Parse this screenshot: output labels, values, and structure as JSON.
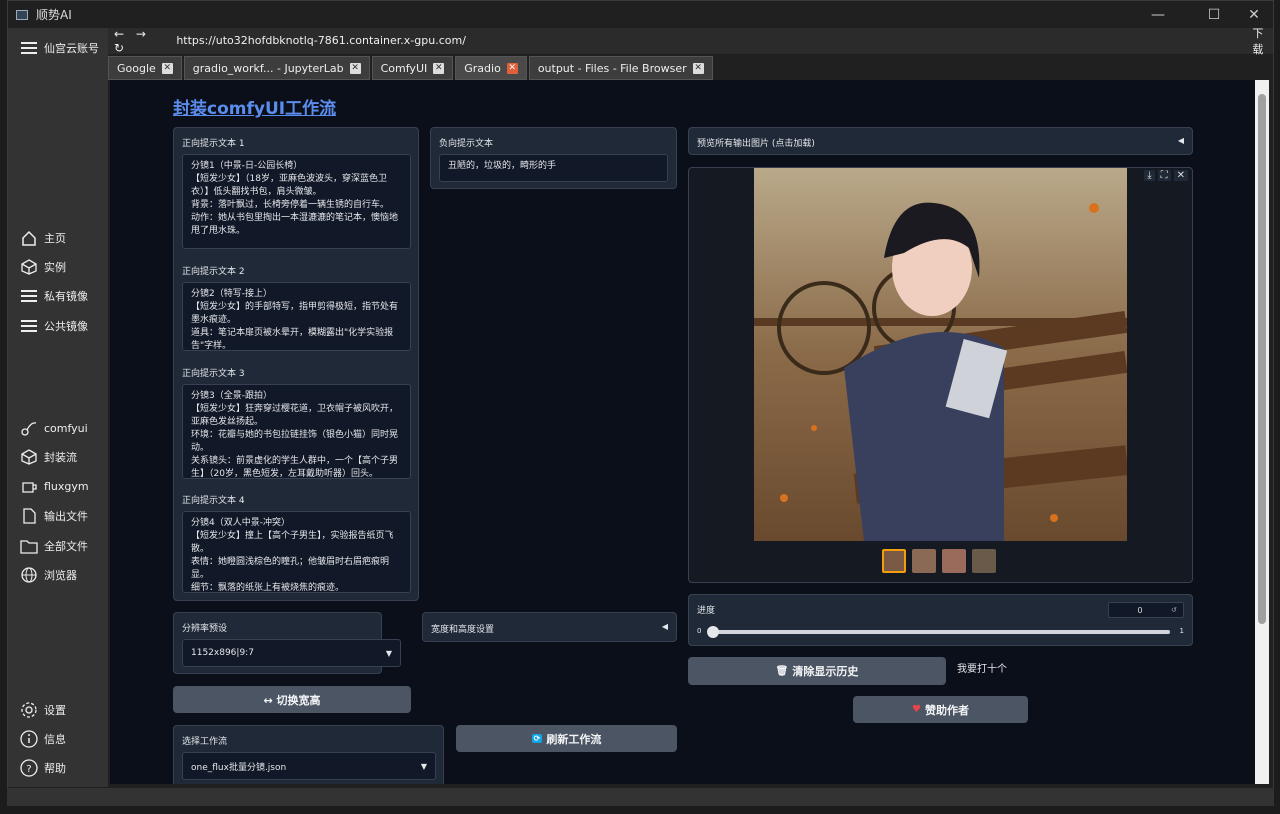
{
  "window": {
    "title": "顺势AI"
  },
  "sidebar": {
    "account": "仙宫云账号",
    "items": [
      {
        "label": "主页",
        "icon": "home-icon"
      },
      {
        "label": "实例",
        "icon": "cube-icon"
      },
      {
        "label": "私有镜像",
        "icon": "layers-icon"
      },
      {
        "label": "公共镜像",
        "icon": "layers-icon"
      }
    ],
    "tools": [
      {
        "label": "comfyui",
        "icon": "comfyui-icon"
      },
      {
        "label": "封装流",
        "icon": "cube-icon"
      },
      {
        "label": "fluxgym",
        "icon": "cup-icon"
      },
      {
        "label": "输出文件",
        "icon": "file-icon"
      },
      {
        "label": "全部文件",
        "icon": "folder-icon"
      },
      {
        "label": "浏览器",
        "icon": "globe-icon"
      }
    ],
    "bottom": [
      {
        "label": "设置",
        "icon": "gear-icon"
      },
      {
        "label": "信息",
        "icon": "info-icon"
      },
      {
        "label": "帮助",
        "icon": "help-icon"
      }
    ]
  },
  "address": {
    "url": "https://uto32hofdbknotlq-7861.container.x-gpu.com/",
    "download": "下载"
  },
  "tabs": [
    {
      "label": "Google"
    },
    {
      "label": "gradio_workf... - JupyterLab"
    },
    {
      "label": "ComfyUI"
    },
    {
      "label": "Gradio"
    },
    {
      "label": "output - Files - File Browser"
    }
  ],
  "page": {
    "title": "封装comfyUI工作流",
    "pos_prompts": [
      {
        "label": "正向提示文本 1",
        "text": "分镜1（中景-日-公园长椅）\n【短发少女】（18岁，亚麻色波波头，穿深蓝色卫衣）】低头翻找书包，肩头微皱。\n背景：落叶飘过，长椅旁停着一辆生锈的自行车。\n动作：她从书包里掏出一本湿漉漉的笔记本，懊恼地甩了甩水珠。"
      },
      {
        "label": "正向提示文本 2",
        "text": "分镜2（特写-接上）\n【短发少女】的手部特写，指甲剪得极短，指节处有墨水痕迹。\n道具：笔记本扉页被水晕开，模糊露出\"化学实验报告\"字样。"
      },
      {
        "label": "正向提示文本 3",
        "text": "分镜3（全景-跟拍）\n【短发少女】狂奔穿过樱花道，卫衣帽子被风吹开，亚麻色发丝扬起。\n环境：花瓣与她的书包拉链挂饰（银色小猫）同时晃动。\n关系镜头：前景虚化的学生人群中，一个【高个子男生】（20岁，黑色短发，左耳戴助听器）回头。"
      },
      {
        "label": "正向提示文本 4",
        "text": "分镜4（双人中景-冲突）\n【短发少女】撞上【高个子男生】，实验报告纸页飞散。\n表情：她瞪圆浅棕色的瞳孔；他皱眉时右眉疤痕明显。\n细节：飘落的纸张上有被烧焦的痕迹。"
      }
    ],
    "neg_prompt": {
      "label": "负向提示文本",
      "text": "丑陋的，垃圾的，畸形的手"
    },
    "gallery_header": "预览所有输出图片 (点击加载)",
    "resolution": {
      "label": "分辨率预设",
      "value": "1152x896|9:7"
    },
    "size_settings": "宽度和高度设置",
    "swap_btn": "↔ 切换宽高",
    "workflow": {
      "label": "选择工作流",
      "value": "one_flux批量分镜.json"
    },
    "refresh_btn": "刷新工作流",
    "progress": {
      "label": "进度",
      "value": "0",
      "min": "0",
      "max": "1",
      "fraction": 0
    },
    "clear_btn": "清除显示历史",
    "note": "我要打十个",
    "sponsor_btn": "赞助作者"
  }
}
